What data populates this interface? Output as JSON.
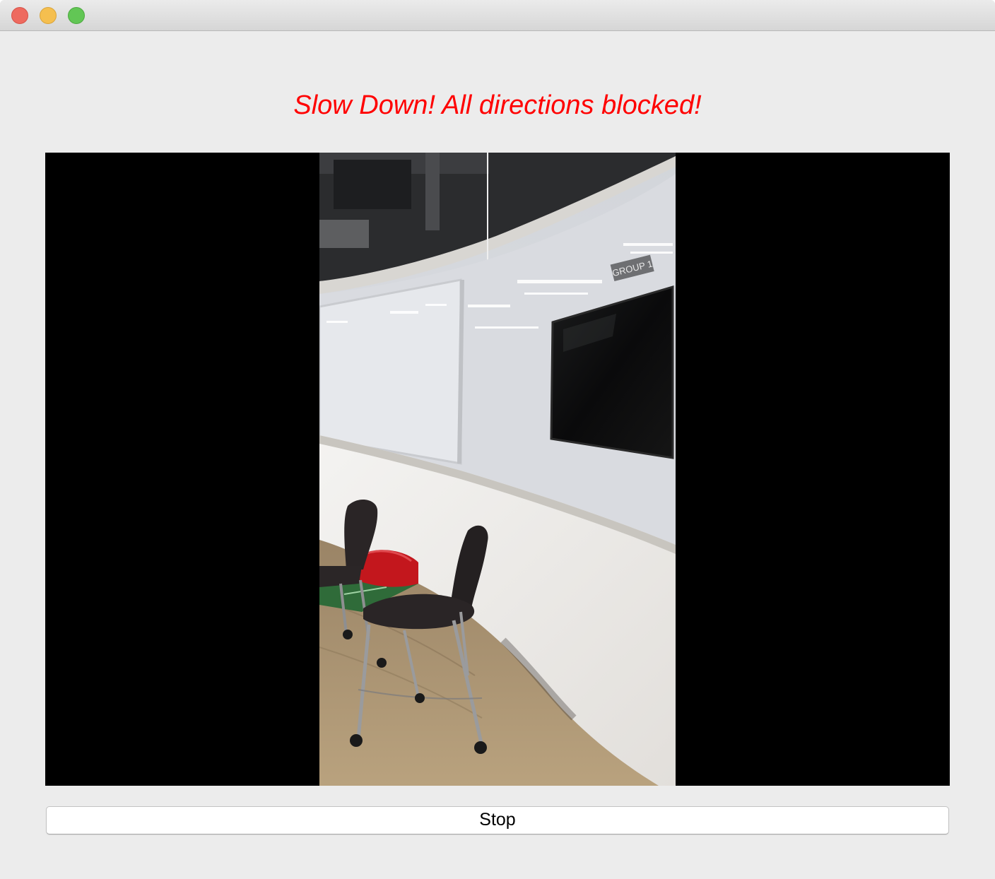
{
  "window": {
    "controls": {
      "close_icon": "close-icon",
      "minimize_icon": "minimize-icon",
      "zoom_icon": "zoom-icon"
    }
  },
  "status": {
    "message": "Slow Down! All directions blocked!",
    "color": "#ff0000"
  },
  "camera": {
    "sign_text": "GROUP 1"
  },
  "controls": {
    "stop_label": "Stop"
  }
}
